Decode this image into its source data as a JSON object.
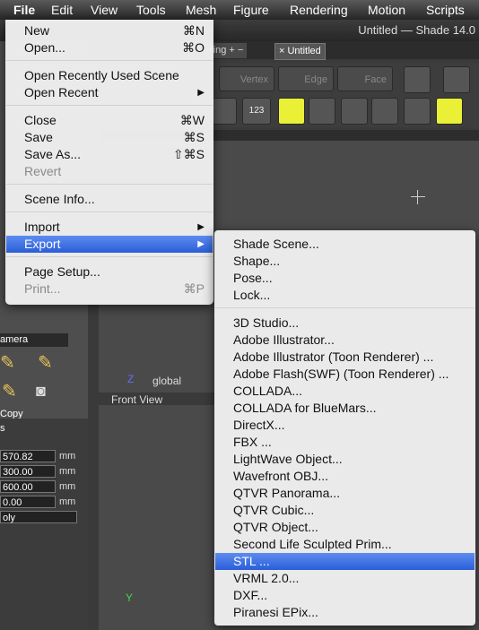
{
  "menubar": {
    "items": [
      "File",
      "Edit",
      "View",
      "Tools",
      "Mesh",
      "Figure",
      "Rendering",
      "Motion",
      "Scripts"
    ]
  },
  "window": {
    "title": "Untitled — Shade 14.0"
  },
  "tabs": [
    {
      "label": "ring + −"
    },
    {
      "label": "× Untitled"
    }
  ],
  "toolbar": {
    "vertex": "Vertex",
    "edge": "Edge",
    "face": "Face",
    "num_btn": "123"
  },
  "sidebar": {
    "camera_label": "amera",
    "copy_label": "Copy",
    "s_label": "s",
    "fields": [
      {
        "value": "570.82",
        "unit": "mm"
      },
      {
        "value": "300.00",
        "unit": "mm"
      },
      {
        "value": "600.00",
        "unit": "mm"
      },
      {
        "value": "0.00",
        "unit": "mm"
      },
      {
        "value": "oly",
        "unit": ""
      }
    ]
  },
  "viewport": {
    "global_label": "global",
    "front_view_label": "Front View",
    "z_axis": "Z",
    "y_axis": "Y"
  },
  "file_menu": {
    "items": [
      {
        "label": "New",
        "shortcut": "⌘N"
      },
      {
        "label": "Open...",
        "shortcut": "⌘O"
      },
      {
        "label": "Open Recently Used Scene",
        "shortcut": ""
      },
      {
        "label": "Open Recent",
        "shortcut": ""
      },
      {
        "label": "Close",
        "shortcut": "⌘W"
      },
      {
        "label": "Save",
        "shortcut": "⌘S"
      },
      {
        "label": "Save As...",
        "shortcut": "⇧⌘S"
      },
      {
        "label": "Revert",
        "shortcut": ""
      },
      {
        "label": "Scene Info...",
        "shortcut": ""
      },
      {
        "label": "Import",
        "shortcut": ""
      },
      {
        "label": "Export",
        "shortcut": ""
      },
      {
        "label": "Page Setup...",
        "shortcut": ""
      },
      {
        "label": "Print...",
        "shortcut": "⌘P"
      }
    ]
  },
  "export_menu": {
    "items": [
      "Shade Scene...",
      "Shape...",
      "Pose...",
      "Lock...",
      "3D Studio...",
      "Adobe Illustrator...",
      "Adobe Illustrator (Toon Renderer) ...",
      "Adobe Flash(SWF) (Toon Renderer) ...",
      "COLLADA...",
      "COLLADA for BlueMars...",
      "DirectX...",
      "FBX ...",
      "LightWave Object...",
      "Wavefront OBJ...",
      "QTVR Panorama...",
      "QTVR Cubic...",
      "QTVR Object...",
      "Second Life Sculpted Prim...",
      "STL ...",
      "VRML 2.0...",
      "DXF...",
      "Piranesi EPix..."
    ],
    "selected": "STL ..."
  },
  "colors": {
    "highlight": "#2a5ed8",
    "accent_yellow": "#e9f036"
  }
}
